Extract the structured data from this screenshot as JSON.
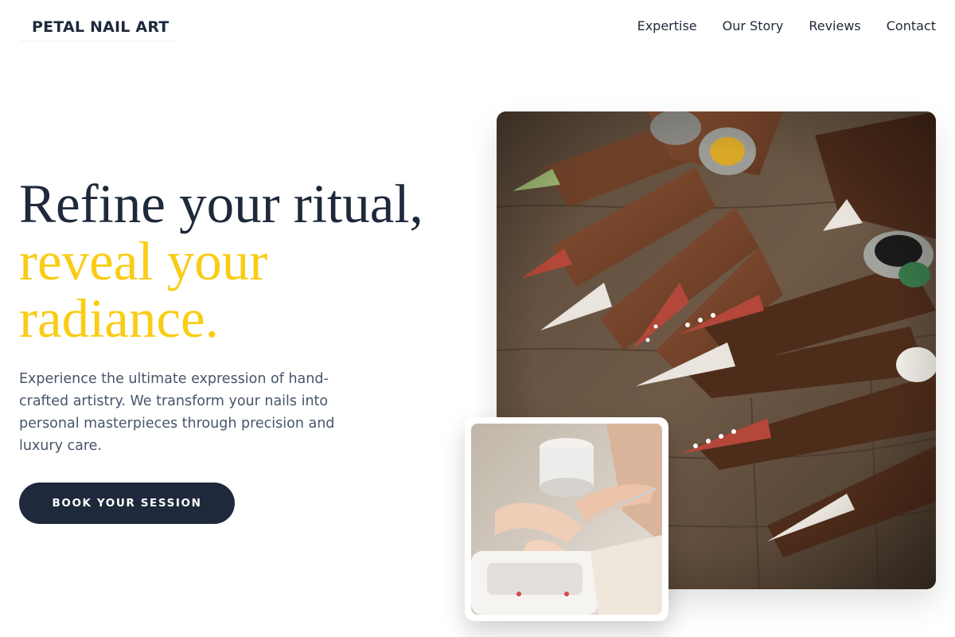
{
  "brand": {
    "name": "PETAL NAIL ART"
  },
  "nav": {
    "items": [
      {
        "label": "Expertise"
      },
      {
        "label": "Our Story"
      },
      {
        "label": "Reviews"
      },
      {
        "label": "Contact"
      }
    ]
  },
  "hero": {
    "headline_line1": "Refine your ritual,",
    "headline_line2": "reveal your radiance.",
    "description": "Experience the ultimate expression of hand-crafted artistry. We transform your nails into personal masterpieces through precision and luxury care.",
    "cta_label": "BOOK YOUR SESSION"
  },
  "images": {
    "main_photo": {
      "alt": "Hands with long decorated nails and rings resting on wood",
      "icon": "photo"
    },
    "small_photo": {
      "alt": "Nail technician applying nail art to a client",
      "icon": "photo"
    }
  },
  "colors": {
    "navy": "#1e293b",
    "accent_yellow": "#facc15",
    "body_text": "#475569",
    "background": "#ffffff"
  }
}
